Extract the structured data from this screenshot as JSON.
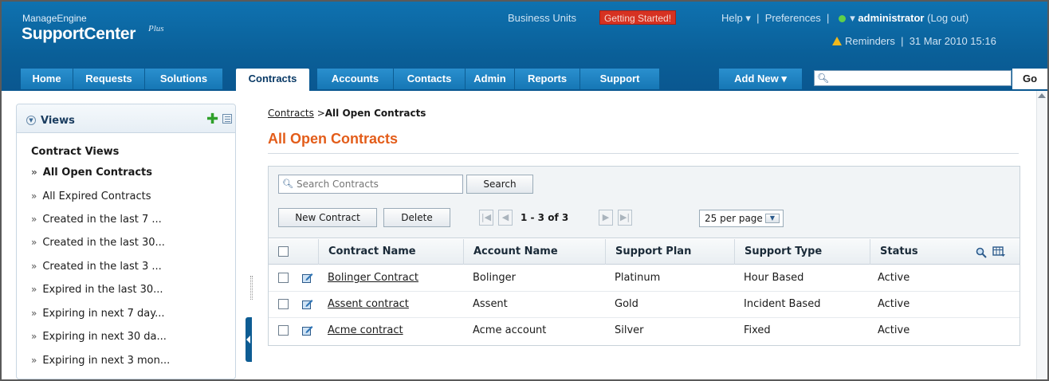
{
  "brand": {
    "small": "ManageEngine",
    "big": "SupportCenter",
    "plus": "Plus"
  },
  "header": {
    "business_units": "Business Units",
    "getting_started": "Getting Started!",
    "help": "Help",
    "preferences": "Preferences",
    "user": "administrator",
    "logout": "(Log out)",
    "reminders": "Reminders",
    "datetime": "31 Mar 2010 15:16"
  },
  "tabs": [
    "Home",
    "Requests",
    "Solutions",
    "Contracts",
    "Accounts",
    "Contacts",
    "Admin",
    "Reports",
    "Support"
  ],
  "active_tab": "Contracts",
  "add_new": "Add New",
  "global_search": {
    "value": "",
    "go": "Go"
  },
  "sidebar": {
    "title": "Views",
    "section_title": "Contract Views",
    "items": [
      {
        "label": "All Open Contracts",
        "active": true
      },
      {
        "label": "All Expired Contracts"
      },
      {
        "label": "Created in the last 7 ..."
      },
      {
        "label": "Created in the last 30..."
      },
      {
        "label": "Created in the last 3 ..."
      },
      {
        "label": "Expired in the last 30..."
      },
      {
        "label": "Expiring in next 7 day..."
      },
      {
        "label": "Expiring in next 30 da..."
      },
      {
        "label": "Expiring in next 3 mon..."
      }
    ]
  },
  "breadcrumb": {
    "parent": "Contracts",
    "sep": ">",
    "current": "All Open Contracts"
  },
  "page_title": "All Open Contracts",
  "toolbar": {
    "search_placeholder": "Search Contracts",
    "search_button": "Search",
    "new_button": "New Contract",
    "delete_button": "Delete",
    "pager": "1 - 3 of 3",
    "per_page": "25 per page"
  },
  "table": {
    "columns": [
      "Contract Name",
      "Account Name",
      "Support Plan",
      "Support Type",
      "Status"
    ],
    "rows": [
      [
        "Bolinger Contract",
        "Bolinger",
        "Platinum",
        "Hour Based",
        "Active"
      ],
      [
        "Assent contract",
        "Assent",
        "Gold",
        "Incident Based",
        "Active"
      ],
      [
        "Acme contract",
        "Acme account",
        "Silver",
        "Fixed",
        "Active"
      ]
    ]
  },
  "colors": {
    "header_blue": "#0a5f98",
    "title_orange": "#e35d1a",
    "getting_started_red": "#d63222"
  }
}
